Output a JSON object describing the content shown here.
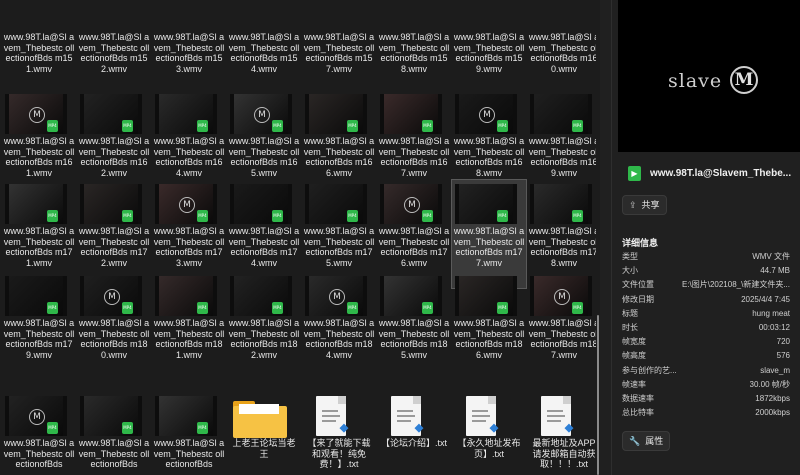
{
  "colors": {
    "accent_badge": "#2fb84a",
    "folder": "#f6c244",
    "background": "#1c1c1c"
  },
  "tiles_row0": [
    {
      "name": "www.98T.la@Slavem_Thebestcollectionof Bds m151.wmv",
      "label": "www.98T.la@Sl avem_Thebestc ollectionofBds m151.wmv"
    },
    {
      "name": "m152",
      "label": "www.98T.la@Sl avem_Thebestc ollectionofBds m152.wmv"
    },
    {
      "name": "m153",
      "label": "www.98T.la@Sl avem_Thebestc ollectionofBds m153.wmv"
    },
    {
      "name": "m154",
      "label": "www.98T.la@Sl avem_Thebestc ollectionofBds m154.wmv"
    },
    {
      "name": "m157",
      "label": "www.98T.la@Sl avem_Thebestc ollectionofBds m157.wmv"
    },
    {
      "name": "m158",
      "label": "www.98T.la@Sl avem_Thebestc ollectionofBds m158.wmv"
    },
    {
      "name": "m159",
      "label": "www.98T.la@Sl avem_Thebestc ollectionofBds m159.wmv"
    },
    {
      "name": "m160",
      "label": "www.98T.la@Sl avem_Thebestc ollectionofBds m160.wmv"
    }
  ],
  "tiles_row1": [
    {
      "label": "www.98T.la@Sl avem_Thebestc ollectionofBds m161.wmv"
    },
    {
      "label": "www.98T.la@Sl avem_Thebestc ollectionofBds m162.wmv"
    },
    {
      "label": "www.98T.la@Sl avem_Thebestc ollectionofBds m164.wmv"
    },
    {
      "label": "www.98T.la@Sl avem_Thebestc ollectionofBds m165.wmv"
    },
    {
      "label": "www.98T.la@Sl avem_Thebestc ollectionofBds m166.wmv"
    },
    {
      "label": "www.98T.la@Sl avem_Thebestc ollectionofBds m167.wmv"
    },
    {
      "label": "www.98T.la@Sl avem_Thebestc ollectionofBds m168.wmv"
    },
    {
      "label": "www.98T.la@Sl avem_Thebestc ollectionofBds m169.wmv"
    }
  ],
  "tiles_row2": [
    {
      "label": "www.98T.la@Sl avem_Thebestc ollectionofBds m171.wmv"
    },
    {
      "label": "www.98T.la@Sl avem_Thebestc ollectionofBds m172.wmv"
    },
    {
      "label": "www.98T.la@Sl avem_Thebestc ollectionofBds m173.wmv"
    },
    {
      "label": "www.98T.la@Sl avem_Thebestc ollectionofBds m174.wmv"
    },
    {
      "label": "www.98T.la@Sl avem_Thebestc ollectionofBds m175.wmv"
    },
    {
      "label": "www.98T.la@Sl avem_Thebestc ollectionofBds m176.wmv"
    },
    {
      "label": "www.98T.la@Sl avem_Thebestc ollectionofBds m177.wmv"
    },
    {
      "label": "www.98T.la@Sl avem_Thebestc ollectionofBds m178.wmv"
    }
  ],
  "tiles_row3": [
    {
      "label": "www.98T.la@Sl avem_Thebestc ollectionofBds m179.wmv"
    },
    {
      "label": "www.98T.la@Sl avem_Thebestc ollectionofBds m180.wmv"
    },
    {
      "label": "www.98T.la@Sl avem_Thebestc ollectionofBds m181.wmv"
    },
    {
      "label": "www.98T.la@Sl avem_Thebestc ollectionofBds m182.wmv"
    },
    {
      "label": "www.98T.la@Sl avem_Thebestc ollectionofBds m184.wmv"
    },
    {
      "label": "www.98T.la@Sl avem_Thebestc ollectionofBds m185.wmv"
    },
    {
      "label": "www.98T.la@Sl avem_Thebestc ollectionofBds m186.wmv"
    },
    {
      "label": "www.98T.la@Sl avem_Thebestc ollectionofBds m187.wmv"
    }
  ],
  "tiles_row4": [
    {
      "label": "www.98T.la@Sl avem_Thebestc ollectionofBds"
    },
    {
      "label": "www.98T.la@Sl avem_Thebestc ollectionofBds"
    },
    {
      "label": "www.98T.la@Sl avem_Thebestc ollectionofBds"
    },
    {
      "label": "上老王论坛当老 王"
    },
    {
      "label": "【来了就能下载 和观看！纯免 费！】.txt"
    },
    {
      "label": "【论坛介绍】.txt"
    },
    {
      "label": "【永久地址发布 页】.txt"
    },
    {
      "label": "最新地址及APP 请发邮箱自动获 取！！！.txt"
    }
  ],
  "thumb_badge": "MP4",
  "details": {
    "preview_brand": "slave",
    "preview_logo": "M",
    "file_icon": "▶",
    "file_name": "www.98T.la@Slavem_Thebe...",
    "share_label": "共享",
    "section_title": "详细信息",
    "props_label": "属性",
    "rows": [
      {
        "k": "类型",
        "v": "WMV 文件"
      },
      {
        "k": "大小",
        "v": "44.7 MB"
      },
      {
        "k": "文件位置",
        "v": "E:\\图片\\202108_\\新建文件夹..."
      },
      {
        "k": "修改日期",
        "v": "2025/4/4 7:45"
      },
      {
        "k": "标题",
        "v": "hung meat"
      },
      {
        "k": "时长",
        "v": "00:03:12"
      },
      {
        "k": "帧宽度",
        "v": "720"
      },
      {
        "k": "帧高度",
        "v": "576"
      },
      {
        "k": "参与创作的艺...",
        "v": "slave_m"
      },
      {
        "k": "帧速率",
        "v": "30.00 帧/秒"
      },
      {
        "k": "数据速率",
        "v": "1872kbps"
      },
      {
        "k": "总比特率",
        "v": "2000kbps"
      }
    ]
  }
}
